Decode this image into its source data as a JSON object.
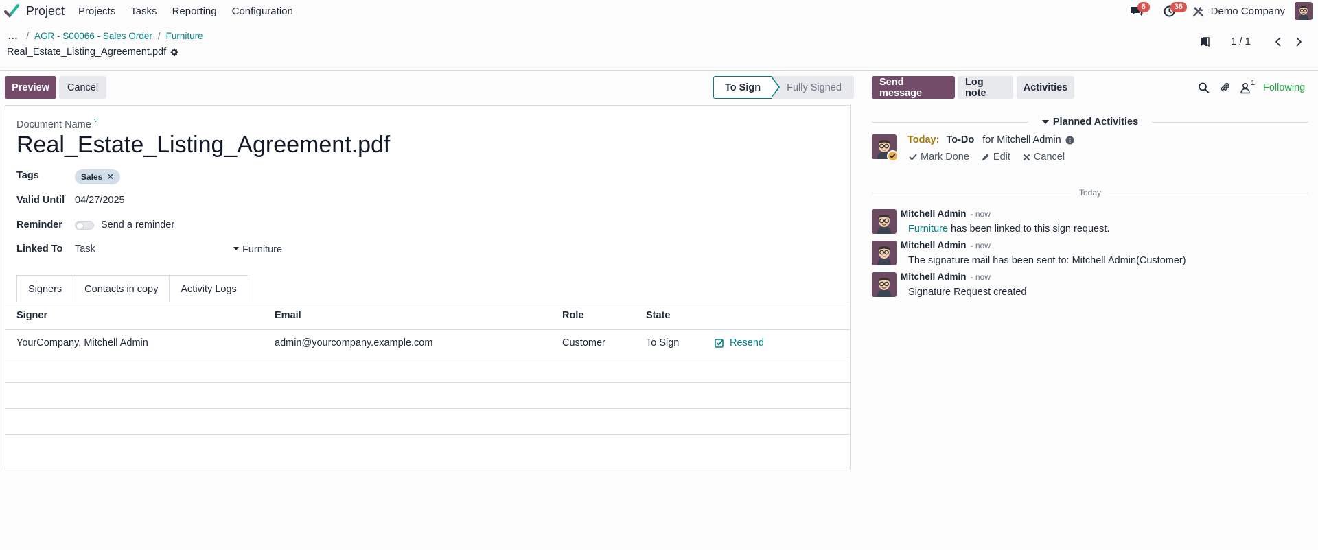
{
  "navbar": {
    "app_name": "Project",
    "menus": [
      "Projects",
      "Tasks",
      "Reporting",
      "Configuration"
    ],
    "messages_badge": "6",
    "activities_badge": "36",
    "company": "Demo Company"
  },
  "breadcrumb": {
    "dots": "...",
    "items": [
      "AGR - S00066 - Sales Order",
      "Furniture"
    ],
    "record_title": "Real_Estate_Listing_Agreement.pdf"
  },
  "pager": {
    "value": "1 / 1"
  },
  "form": {
    "buttons": {
      "preview": "Preview",
      "cancel": "Cancel"
    },
    "status": {
      "current": "To Sign",
      "next": "Fully Signed"
    },
    "document_name_label": "Document Name",
    "help_mark": "?",
    "document_name": "Real_Estate_Listing_Agreement.pdf",
    "tags_label": "Tags",
    "tag": "Sales",
    "valid_until_label": "Valid Until",
    "valid_until": "04/27/2025",
    "reminder_label": "Reminder",
    "reminder_text": "Send a reminder",
    "linked_to_label": "Linked To",
    "linked_model": "Task",
    "linked_record": "Furniture",
    "tabs": [
      "Signers",
      "Contacts in copy",
      "Activity Logs"
    ],
    "table": {
      "headers": [
        "Signer",
        "Email",
        "Role",
        "State"
      ],
      "rows": [
        {
          "signer": "YourCompany, Mitchell Admin",
          "email": "admin@yourcompany.example.com",
          "role": "Customer",
          "state": "To Sign",
          "action": "Resend"
        }
      ]
    }
  },
  "chatter": {
    "send_message": "Send message",
    "log_note": "Log note",
    "activities": "Activities",
    "follower_count": "1",
    "following": "Following",
    "planned_title": "Planned Activities",
    "activity": {
      "when": "Today:",
      "type": "To-Do",
      "assignee": "for Mitchell Admin",
      "mark_done": "Mark Done",
      "edit": "Edit",
      "cancel": "Cancel"
    },
    "date_separator": "Today",
    "messages": [
      {
        "author": "Mitchell Admin",
        "date": "- now",
        "link": "Furniture",
        "body": " has been linked to this sign request."
      },
      {
        "author": "Mitchell Admin",
        "date": "- now",
        "body": "The signature mail has been sent to: Mitchell Admin(Customer)"
      },
      {
        "author": "Mitchell Admin",
        "date": "- now",
        "body": "Signature Request created"
      }
    ]
  },
  "colors": {
    "primary": "#714b67",
    "link": "#017e84",
    "following": "#28a745",
    "today": "#a2790a",
    "badge": "#d9534f"
  }
}
